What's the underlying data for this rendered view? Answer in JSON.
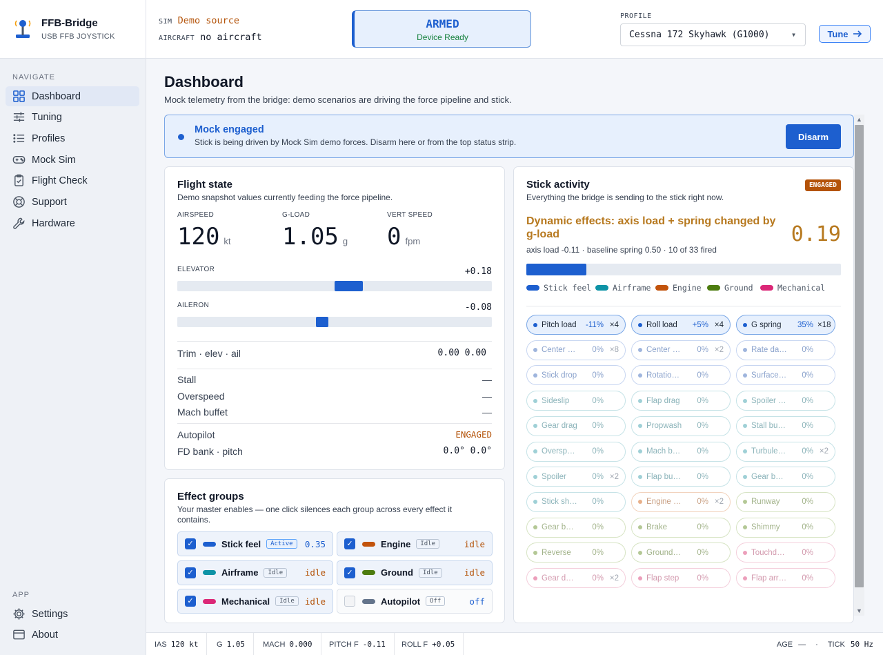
{
  "brand": {
    "name": "FFB-Bridge",
    "subtitle": "USB FFB JOYSTICK"
  },
  "sidebar": {
    "navigate_heading": "NAVIGATE",
    "items": [
      {
        "label": "Dashboard",
        "icon": "grid-icon",
        "active": true
      },
      {
        "label": "Tuning",
        "icon": "sliders-icon"
      },
      {
        "label": "Profiles",
        "icon": "list-icon"
      },
      {
        "label": "Mock Sim",
        "icon": "gamepad-icon"
      },
      {
        "label": "Flight Check",
        "icon": "clipboard-check-icon"
      },
      {
        "label": "Support",
        "icon": "lifebuoy-icon"
      },
      {
        "label": "Hardware",
        "icon": "wrench-icon"
      }
    ],
    "app_heading": "APP",
    "app_items": [
      {
        "label": "Settings",
        "icon": "gear-icon"
      },
      {
        "label": "About",
        "icon": "window-icon"
      }
    ]
  },
  "topbar": {
    "sim_label": "SIM",
    "sim_value": "Demo source",
    "aircraft_label": "AIRCRAFT",
    "aircraft_value": "no aircraft",
    "armed_title": "ARMED",
    "armed_sub": "Device Ready",
    "profile_label": "PROFILE",
    "profile_value": "Cessna 172 Skyhawk (G1000)",
    "tune_label": "Tune"
  },
  "page": {
    "title": "Dashboard",
    "subtitle": "Mock telemetry from the bridge: demo scenarios are driving the force pipeline and stick."
  },
  "banner": {
    "title": "Mock engaged",
    "text": "Stick is being driven by Mock Sim demo forces. Disarm here or from the top status strip.",
    "button": "Disarm"
  },
  "flight_state": {
    "title": "Flight state",
    "subtitle": "Demo snapshot values currently feeding the force pipeline.",
    "airspeed": {
      "label": "AIRSPEED",
      "value": "120",
      "unit": "kt"
    },
    "gload": {
      "label": "G-LOAD",
      "value": "1.05",
      "unit": "g"
    },
    "vspeed": {
      "label": "VERT SPEED",
      "value": "0",
      "unit": "fpm"
    },
    "elevator": {
      "label": "ELEVATOR",
      "value": "+0.18",
      "level": 0.18
    },
    "aileron": {
      "label": "AILERON",
      "value": "-0.08",
      "level": -0.08
    },
    "trim": {
      "label": "Trim · elev · ail",
      "value": "0.00 0.00"
    },
    "stall": {
      "label": "Stall",
      "value": "—"
    },
    "overspeed": {
      "label": "Overspeed",
      "value": "—"
    },
    "mach": {
      "label": "Mach buffet",
      "value": "—"
    },
    "autopilot": {
      "label": "Autopilot",
      "value": "ENGAGED"
    },
    "fd": {
      "label": "FD bank · pitch",
      "value": "0.0° 0.0°"
    }
  },
  "effect_groups": {
    "title": "Effect groups",
    "subtitle": "Your master enables — one click silences each group across every effect it contains.",
    "groups": [
      {
        "name": "Stick feel",
        "badge": "Active",
        "value": "0.35",
        "checked": true,
        "color": "#1d5fcf"
      },
      {
        "name": "Engine",
        "badge": "Idle",
        "value": "idle",
        "checked": true,
        "color": "#c2530c"
      },
      {
        "name": "Airframe",
        "badge": "Idle",
        "value": "idle",
        "checked": true,
        "color": "#0e93a6"
      },
      {
        "name": "Ground",
        "badge": "Idle",
        "value": "idle",
        "checked": true,
        "color": "#4d7c0f"
      },
      {
        "name": "Mechanical",
        "badge": "Idle",
        "value": "idle",
        "checked": true,
        "color": "#db2777"
      },
      {
        "name": "Autopilot",
        "badge": "Off",
        "value": "off",
        "checked": false,
        "color": "#64748b"
      }
    ]
  },
  "stick_activity": {
    "title": "Stick activity",
    "subtitle": "Everything the bridge is sending to the stick right now.",
    "badge": "ENGAGED",
    "headline": "Dynamic effects: axis load + spring changed by g-load",
    "value": "0.19",
    "detail": "axis load -0.11 · baseline spring 0.50 · 10 of 33 fired",
    "progress": 0.19,
    "legend": [
      {
        "name": "Stick feel",
        "color": "#1d5fcf"
      },
      {
        "name": "Airframe",
        "color": "#0e93a6"
      },
      {
        "name": "Engine",
        "color": "#c2530c"
      },
      {
        "name": "Ground",
        "color": "#4d7c0f"
      },
      {
        "name": "Mechanical",
        "color": "#db2777"
      }
    ],
    "chips": [
      {
        "name": "Pitch load",
        "pct": "-11%",
        "mult": "×4",
        "group": "stick",
        "active": true
      },
      {
        "name": "Roll load",
        "pct": "+5%",
        "mult": "×4",
        "group": "stick",
        "active": true
      },
      {
        "name": "G spring",
        "pct": "35%",
        "mult": "×18",
        "group": "stick",
        "active": true
      },
      {
        "name": "Center pitch",
        "pct": "0%",
        "mult": "×8",
        "group": "stick"
      },
      {
        "name": "Center roll",
        "pct": "0%",
        "mult": "×2",
        "group": "stick"
      },
      {
        "name": "Rate damp",
        "pct": "0%",
        "mult": "",
        "group": "stick"
      },
      {
        "name": "Stick drop",
        "pct": "0%",
        "mult": "",
        "group": "stick"
      },
      {
        "name": "Rotation kick",
        "pct": "0%",
        "mult": "",
        "group": "stick"
      },
      {
        "name": "Surface follow",
        "pct": "0%",
        "mult": "",
        "group": "stick"
      },
      {
        "name": "Sideslip",
        "pct": "0%",
        "mult": "",
        "group": "airframe"
      },
      {
        "name": "Flap drag",
        "pct": "0%",
        "mult": "",
        "group": "airframe"
      },
      {
        "name": "Spoiler drag",
        "pct": "0%",
        "mult": "",
        "group": "airframe"
      },
      {
        "name": "Gear drag",
        "pct": "0%",
        "mult": "",
        "group": "airframe"
      },
      {
        "name": "Propwash",
        "pct": "0%",
        "mult": "",
        "group": "airframe"
      },
      {
        "name": "Stall buffet",
        "pct": "0%",
        "mult": "",
        "group": "airframe"
      },
      {
        "name": "Overspeed",
        "pct": "0%",
        "mult": "",
        "group": "airframe"
      },
      {
        "name": "Mach buffet",
        "pct": "0%",
        "mult": "",
        "group": "airframe"
      },
      {
        "name": "Turbulence",
        "pct": "0%",
        "mult": "×2",
        "group": "airframe"
      },
      {
        "name": "Spoiler",
        "pct": "0%",
        "mult": "×2",
        "group": "airframe"
      },
      {
        "name": "Flap buffet",
        "pct": "0%",
        "mult": "",
        "group": "airframe"
      },
      {
        "name": "Gear buffet",
        "pct": "0%",
        "mult": "",
        "group": "airframe"
      },
      {
        "name": "Stick shaker",
        "pct": "0%",
        "mult": "",
        "group": "airframe"
      },
      {
        "name": "Engine rum...",
        "pct": "0%",
        "mult": "×2",
        "group": "engine"
      },
      {
        "name": "Runway",
        "pct": "0%",
        "mult": "",
        "group": "ground"
      },
      {
        "name": "Gear bumps",
        "pct": "0%",
        "mult": "",
        "group": "ground"
      },
      {
        "name": "Brake",
        "pct": "0%",
        "mult": "",
        "group": "ground"
      },
      {
        "name": "Shimmy",
        "pct": "0%",
        "mult": "",
        "group": "ground"
      },
      {
        "name": "Reverse",
        "pct": "0%",
        "mult": "",
        "group": "ground"
      },
      {
        "name": "Ground accel",
        "pct": "0%",
        "mult": "",
        "group": "ground"
      },
      {
        "name": "Touchdown",
        "pct": "0%",
        "mult": "",
        "group": "mech"
      },
      {
        "name": "Gear deploy",
        "pct": "0%",
        "mult": "×2",
        "group": "mech"
      },
      {
        "name": "Flap step",
        "pct": "0%",
        "mult": "",
        "group": "mech"
      },
      {
        "name": "Flap arrival",
        "pct": "0%",
        "mult": "",
        "group": "mech"
      }
    ]
  },
  "statusbar": {
    "ias_label": "IAS",
    "ias": "120 kt",
    "g_label": "G",
    "g": "1.05",
    "mach_label": "MACH",
    "mach": "0.000",
    "pitch_label": "PITCH F",
    "pitch": "-0.11",
    "roll_label": "ROLL F",
    "roll": "+0.05",
    "age_label": "AGE",
    "age": "—",
    "dot": "·",
    "tick_label": "TICK",
    "tick": "50 Hz"
  }
}
